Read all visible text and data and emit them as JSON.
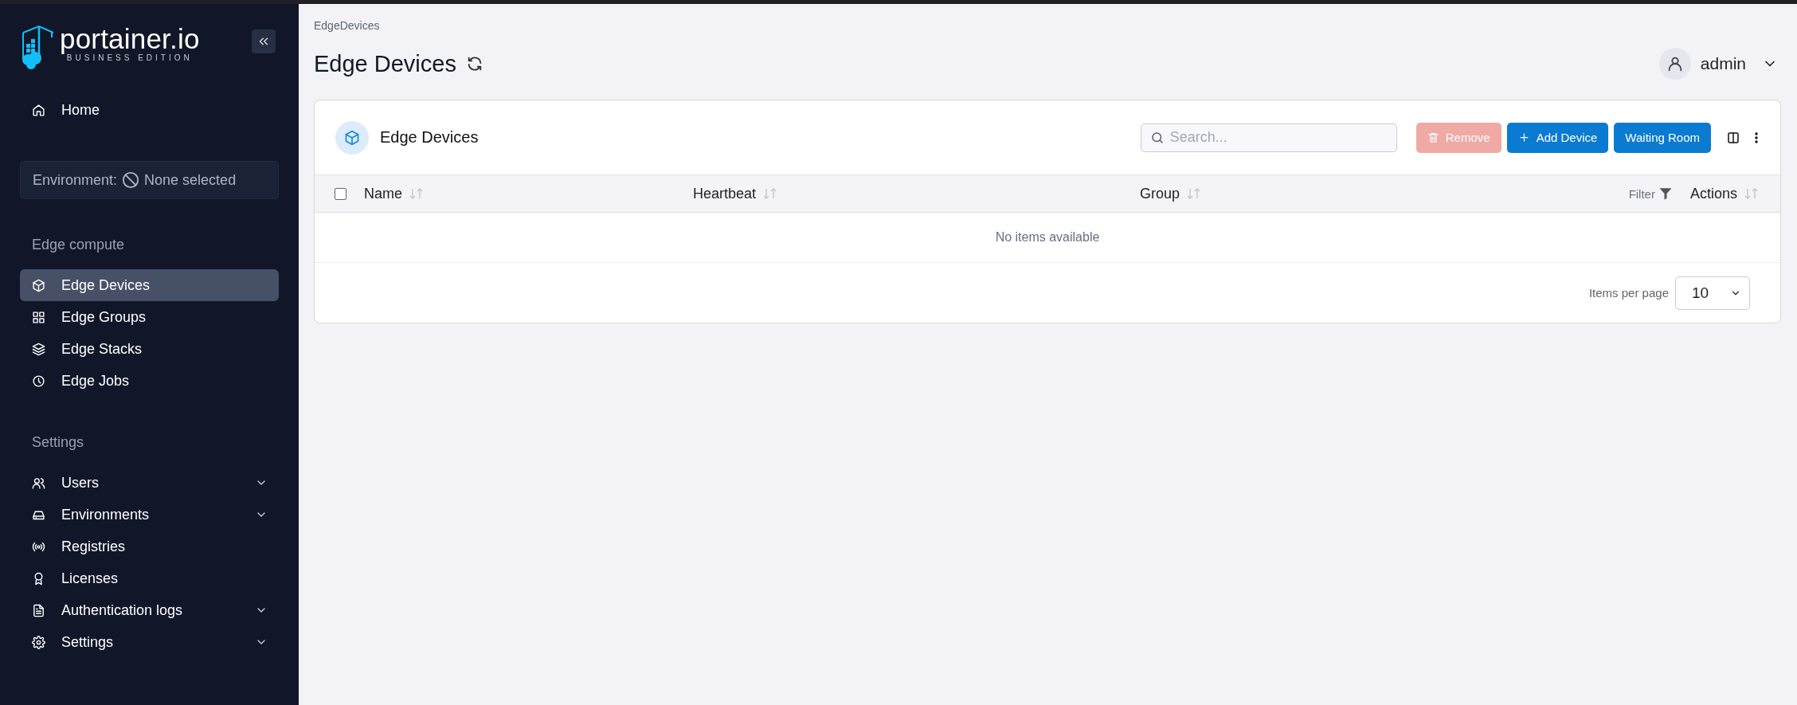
{
  "sidebar": {
    "logo": {
      "name": "portainer.io",
      "edition": "BUSINESS EDITION"
    },
    "home": {
      "label": "Home",
      "selected": false
    },
    "environment": {
      "label": "Environment:",
      "value": "None selected"
    },
    "sections": [
      {
        "title": "Edge compute",
        "items": [
          {
            "label": "Edge Devices",
            "selected": true,
            "expandable": false
          },
          {
            "label": "Edge Groups",
            "selected": false,
            "expandable": false
          },
          {
            "label": "Edge Stacks",
            "selected": false,
            "expandable": false
          },
          {
            "label": "Edge Jobs",
            "selected": false,
            "expandable": false
          }
        ]
      },
      {
        "title": "Settings",
        "items": [
          {
            "label": "Users",
            "selected": false,
            "expandable": true
          },
          {
            "label": "Environments",
            "selected": false,
            "expandable": true
          },
          {
            "label": "Registries",
            "selected": false,
            "expandable": false
          },
          {
            "label": "Licenses",
            "selected": false,
            "expandable": false
          },
          {
            "label": "Authentication logs",
            "selected": false,
            "expandable": true
          },
          {
            "label": "Settings",
            "selected": false,
            "expandable": true
          }
        ]
      }
    ]
  },
  "breadcrumb": "EdgeDevices",
  "page_title": "Edge Devices",
  "user": {
    "name": "admin"
  },
  "card": {
    "title": "Edge Devices",
    "search": {
      "placeholder": "Search..."
    },
    "buttons": [
      {
        "label": "Remove",
        "kind": "danger",
        "disabled": true
      },
      {
        "label": "Add Device",
        "kind": "primary",
        "disabled": false
      },
      {
        "label": "Waiting Room",
        "kind": "primary",
        "disabled": false
      }
    ],
    "table": {
      "select_all": {
        "checked": false
      },
      "columns": [
        {
          "label": "Name"
        },
        {
          "label": "Heartbeat"
        },
        {
          "label": "Group"
        },
        {
          "label": "Actions"
        }
      ],
      "filter_label": "Filter",
      "empty_message": "No items available"
    },
    "pagination": {
      "label": "Items per page",
      "value": "10"
    }
  }
}
